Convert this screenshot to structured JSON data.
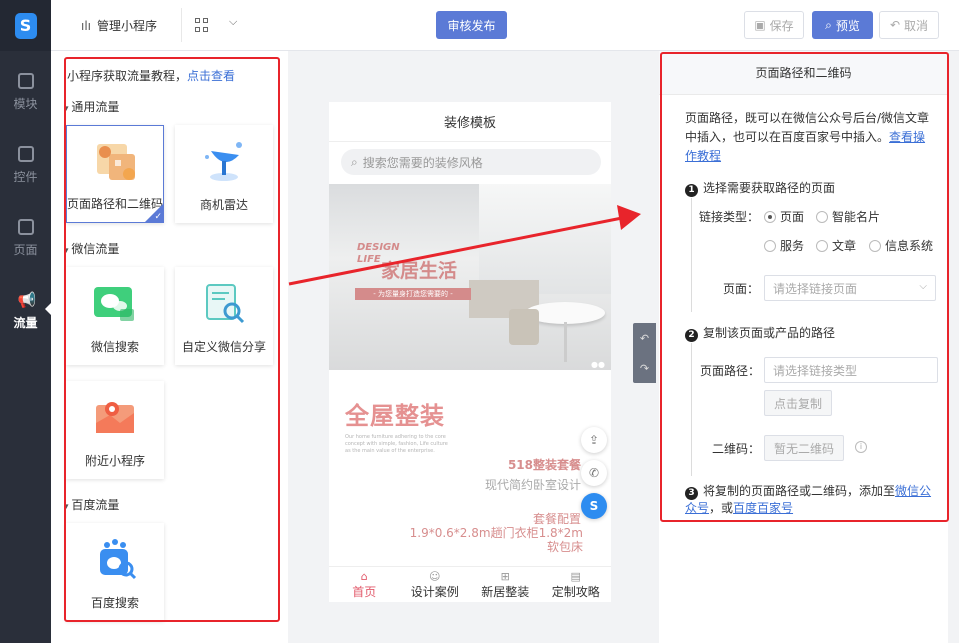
{
  "nav": {
    "logo": "S",
    "items": [
      {
        "label": "模块",
        "icon": "module-icon"
      },
      {
        "label": "控件",
        "icon": "widget-icon"
      },
      {
        "label": "页面",
        "icon": "page-icon"
      },
      {
        "label": "流量",
        "icon": "megaphone-icon",
        "active": true
      }
    ]
  },
  "topbar": {
    "app_name": "管理小程序",
    "publish": "审核发布",
    "save": "保存",
    "preview": "预览",
    "undo": "取消"
  },
  "left_panel": {
    "tutorial_text": "小程序获取流量教程，",
    "tutorial_link": "点击查看",
    "sections": [
      {
        "title": "通用流量",
        "cards": [
          {
            "label": "页面路径和二维码",
            "selected": true
          },
          {
            "label": "商机雷达"
          }
        ]
      },
      {
        "title": "微信流量",
        "cards": [
          {
            "label": "微信搜索"
          },
          {
            "label": "自定义微信分享"
          },
          {
            "label": "附近小程序"
          }
        ]
      },
      {
        "title": "百度流量",
        "cards": [
          {
            "label": "百度搜索"
          }
        ]
      }
    ]
  },
  "phone": {
    "title": "装修模板",
    "search_placeholder": "搜索您需要的装修风格",
    "banner": {
      "design": "DESIGN",
      "life": "LIFE",
      "headline": "家居生活",
      "sub": "- 为您量身打造您需要的 -"
    },
    "section": {
      "title": "全屋整装",
      "small_text": "Our home furniture adhering to the core concept with simple, fashion, Life culture as the main value of the enterprise.",
      "promo1": "518整装套餐",
      "promo2": "现代简约卧室设计",
      "promo3": "套餐配置",
      "promo4": "1.9*0.6*2.8m趟门衣柜1.8*2m软包床"
    },
    "tabs": [
      {
        "label": "首页",
        "active": true,
        "icon": "home-icon"
      },
      {
        "label": "设计案例",
        "icon": "user-icon"
      },
      {
        "label": "新居整装",
        "icon": "grid-icon"
      },
      {
        "label": "定制攻略",
        "icon": "doc-icon"
      }
    ]
  },
  "right_panel": {
    "title": "页面路径和二维码",
    "desc": "页面路径，既可以在微信公众号后台/微信文章中插入，也可以在百度百家号中插入。",
    "desc_link": "查看操作教程",
    "step1": "选择需要获取路径的页面",
    "link_type_label": "链接类型：",
    "radios": [
      {
        "label": "页面",
        "checked": true
      },
      {
        "label": "智能名片"
      },
      {
        "label": "服务"
      },
      {
        "label": "文章"
      },
      {
        "label": "信息系统"
      }
    ],
    "page_label": "页面：",
    "page_placeholder": "请选择链接页面",
    "step2": "复制该页面或产品的路径",
    "path_label": "页面路径：",
    "path_placeholder": "请选择链接类型",
    "copy_button": "点击复制",
    "qr_label": "二维码：",
    "qr_button": "暂无二维码",
    "step3_text": "将复制的页面路径或二维码，添加至",
    "step3_link1": "微信公众号",
    "step3_mid": "，或",
    "step3_link2": "百度百家号"
  },
  "colors": {
    "accent": "#5b7ad6",
    "highlight": "#e8242b",
    "nav_bg": "#2a2f3a"
  }
}
